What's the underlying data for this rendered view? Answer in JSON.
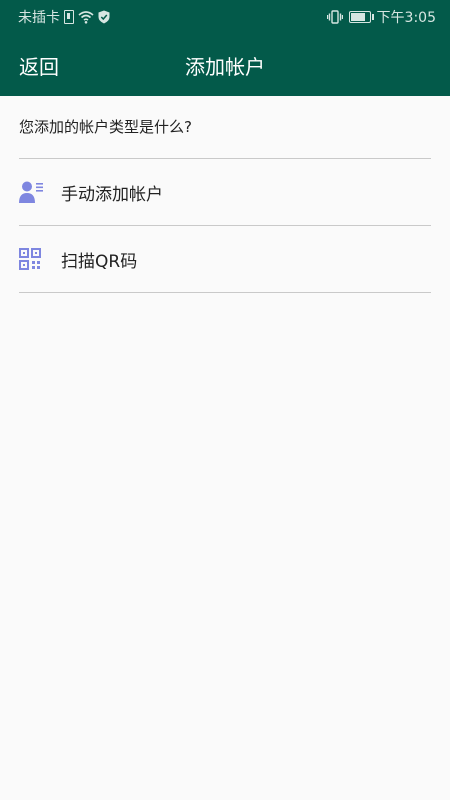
{
  "status_bar": {
    "carrier": "未插卡",
    "time": "下午3:05",
    "battery_level": 0.85
  },
  "toolbar": {
    "back_label": "返回",
    "title": "添加帐户"
  },
  "prompt": "您添加的帐户类型是什么?",
  "options": [
    {
      "label": "手动添加帐户",
      "icon": "person-card-icon"
    },
    {
      "label": "扫描QR码",
      "icon": "qr-code-icon"
    }
  ],
  "colors": {
    "toolbar": "#035a4a",
    "icon_accent": "#7e86e0",
    "divider": "#c9c9c9",
    "background": "#fafafa"
  }
}
